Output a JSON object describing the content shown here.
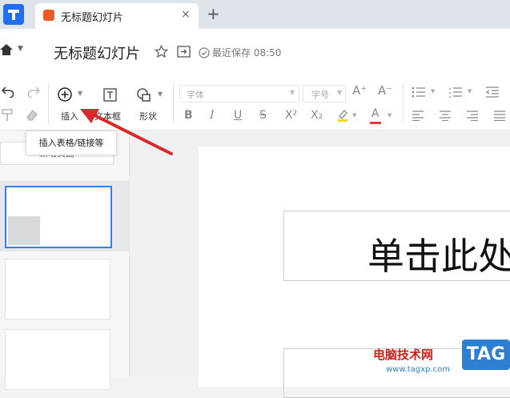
{
  "tab": {
    "title": "无标题幻灯片",
    "close_label": "×",
    "new_tab_label": "+"
  },
  "header": {
    "doc_title": "无标题幻灯片",
    "save_status": "最近保存 08:50"
  },
  "toolbar": {
    "insert_label": "插入",
    "textbox_label": "文本框",
    "shape_label": "形状",
    "font_placeholder": "字体",
    "font_size_placeholder": "字号",
    "bold": "B",
    "italic": "I",
    "underline": "U",
    "strike": "S",
    "superscript": "X²",
    "subscript": "X₂",
    "font_color": "A",
    "grow_font": "A⁺",
    "shrink_font": "A⁻"
  },
  "tooltip": {
    "text": "插入表格/链接等"
  },
  "left_pane": {
    "new_slide_label": "新增页面"
  },
  "slide": {
    "title_placeholder": "单击此处"
  },
  "watermark": {
    "site_text": "电脑技术网",
    "url": "www.tagxp.com",
    "tag": "TAG"
  },
  "colors": {
    "accent": "#3b7ded",
    "arrow": "#d9282a",
    "tab_icon": "#ec5a27"
  }
}
